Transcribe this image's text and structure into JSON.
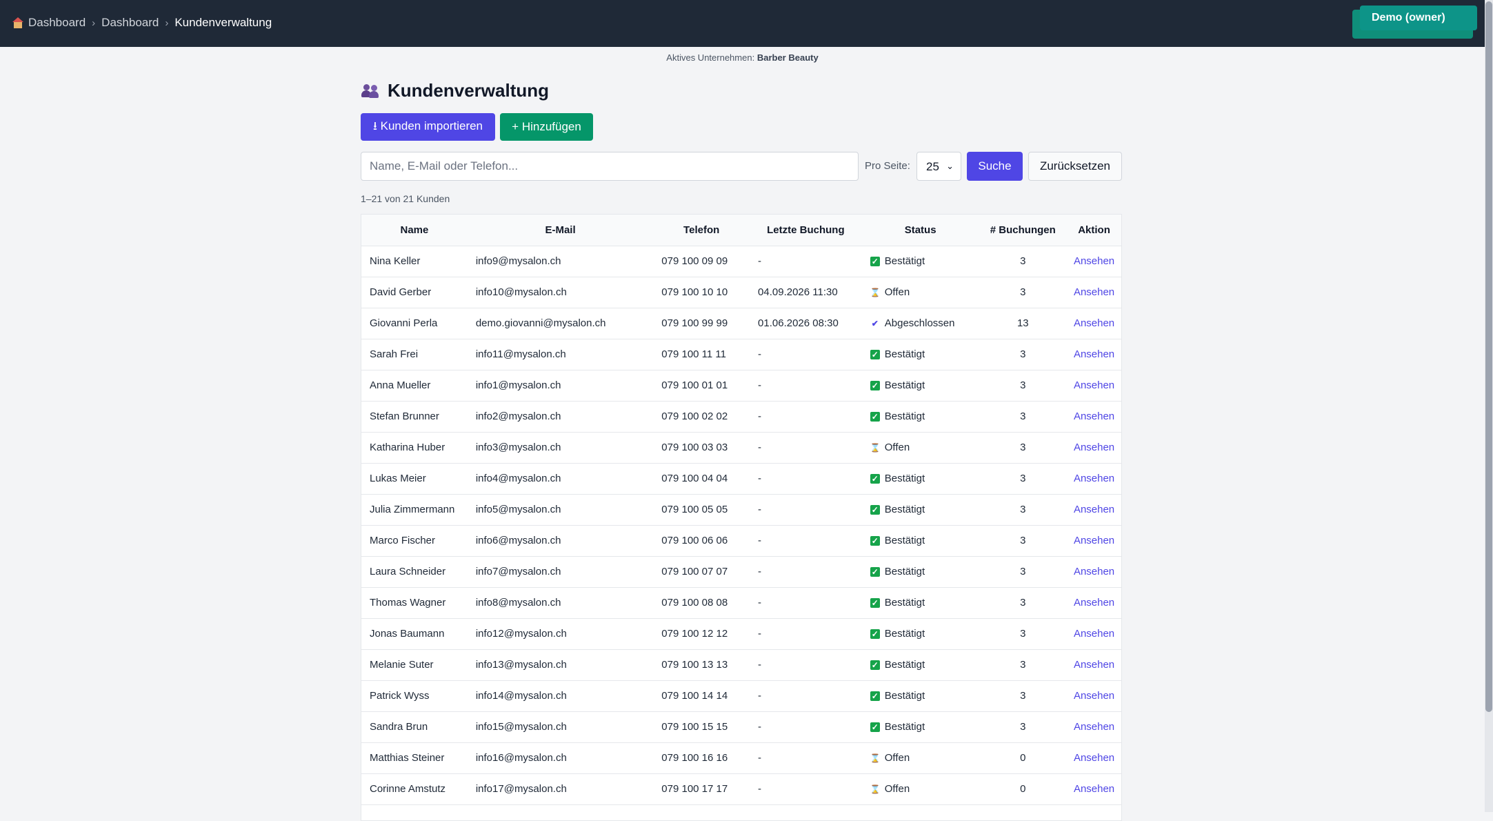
{
  "breadcrumb": {
    "home": "Dashboard",
    "parent": "Dashboard",
    "current": "Kundenverwaltung"
  },
  "user_badge": "Demo (owner)",
  "active_company": {
    "label": "Aktives Unternehmen:",
    "name": "Barber Beauty"
  },
  "page_title": "Kundenverwaltung",
  "toolbar": {
    "import_label": "⭳ Kunden importieren",
    "add_label": "+ Hinzufügen"
  },
  "search": {
    "placeholder": "Name, E-Mail oder Telefon...",
    "per_page_label": "Pro Seite:",
    "per_page_value": "25",
    "search_label": "Suche",
    "reset_label": "Zurücksetzen"
  },
  "result_count": "1–21 von 21 Kunden",
  "table": {
    "headers": [
      "Name",
      "E-Mail",
      "Telefon",
      "Letzte Buchung",
      "Status",
      "# Buchungen",
      "Aktion"
    ],
    "rows": [
      {
        "name": "Nina Keller",
        "email": "info9@mysalon.ch",
        "phone": "079 100 09 09",
        "last": "-",
        "status": "Bestätigt",
        "status_icon": "check-box-icon",
        "count": "3",
        "action": "Ansehen"
      },
      {
        "name": "David Gerber",
        "email": "info10@mysalon.ch",
        "phone": "079 100 10 10",
        "last": "04.09.2026 11:30",
        "status": "Offen",
        "status_icon": "hourglass-icon",
        "count": "3",
        "action": "Ansehen"
      },
      {
        "name": "Giovanni Perla",
        "email": "demo.giovanni@mysalon.ch",
        "phone": "079 100 99 99",
        "last": "01.06.2026 08:30",
        "status": "Abgeschlossen",
        "status_icon": "check-icon",
        "count": "13",
        "action": "Ansehen"
      },
      {
        "name": "Sarah Frei",
        "email": "info11@mysalon.ch",
        "phone": "079 100 11 11",
        "last": "-",
        "status": "Bestätigt",
        "status_icon": "check-box-icon",
        "count": "3",
        "action": "Ansehen"
      },
      {
        "name": "Anna Mueller",
        "email": "info1@mysalon.ch",
        "phone": "079 100 01 01",
        "last": "-",
        "status": "Bestätigt",
        "status_icon": "check-box-icon",
        "count": "3",
        "action": "Ansehen"
      },
      {
        "name": "Stefan Brunner",
        "email": "info2@mysalon.ch",
        "phone": "079 100 02 02",
        "last": "-",
        "status": "Bestätigt",
        "status_icon": "check-box-icon",
        "count": "3",
        "action": "Ansehen"
      },
      {
        "name": "Katharina Huber",
        "email": "info3@mysalon.ch",
        "phone": "079 100 03 03",
        "last": "-",
        "status": "Offen",
        "status_icon": "hourglass-icon",
        "count": "3",
        "action": "Ansehen"
      },
      {
        "name": "Lukas Meier",
        "email": "info4@mysalon.ch",
        "phone": "079 100 04 04",
        "last": "-",
        "status": "Bestätigt",
        "status_icon": "check-box-icon",
        "count": "3",
        "action": "Ansehen"
      },
      {
        "name": "Julia Zimmermann",
        "email": "info5@mysalon.ch",
        "phone": "079 100 05 05",
        "last": "-",
        "status": "Bestätigt",
        "status_icon": "check-box-icon",
        "count": "3",
        "action": "Ansehen"
      },
      {
        "name": "Marco Fischer",
        "email": "info6@mysalon.ch",
        "phone": "079 100 06 06",
        "last": "-",
        "status": "Bestätigt",
        "status_icon": "check-box-icon",
        "count": "3",
        "action": "Ansehen"
      },
      {
        "name": "Laura Schneider",
        "email": "info7@mysalon.ch",
        "phone": "079 100 07 07",
        "last": "-",
        "status": "Bestätigt",
        "status_icon": "check-box-icon",
        "count": "3",
        "action": "Ansehen"
      },
      {
        "name": "Thomas Wagner",
        "email": "info8@mysalon.ch",
        "phone": "079 100 08 08",
        "last": "-",
        "status": "Bestätigt",
        "status_icon": "check-box-icon",
        "count": "3",
        "action": "Ansehen"
      },
      {
        "name": "Jonas Baumann",
        "email": "info12@mysalon.ch",
        "phone": "079 100 12 12",
        "last": "-",
        "status": "Bestätigt",
        "status_icon": "check-box-icon",
        "count": "3",
        "action": "Ansehen"
      },
      {
        "name": "Melanie Suter",
        "email": "info13@mysalon.ch",
        "phone": "079 100 13 13",
        "last": "-",
        "status": "Bestätigt",
        "status_icon": "check-box-icon",
        "count": "3",
        "action": "Ansehen"
      },
      {
        "name": "Patrick Wyss",
        "email": "info14@mysalon.ch",
        "phone": "079 100 14 14",
        "last": "-",
        "status": "Bestätigt",
        "status_icon": "check-box-icon",
        "count": "3",
        "action": "Ansehen"
      },
      {
        "name": "Sandra Brun",
        "email": "info15@mysalon.ch",
        "phone": "079 100 15 15",
        "last": "-",
        "status": "Bestätigt",
        "status_icon": "check-box-icon",
        "count": "3",
        "action": "Ansehen"
      },
      {
        "name": "Matthias Steiner",
        "email": "info16@mysalon.ch",
        "phone": "079 100 16 16",
        "last": "-",
        "status": "Offen",
        "status_icon": "hourglass-icon",
        "count": "0",
        "action": "Ansehen"
      },
      {
        "name": "Corinne Amstutz",
        "email": "info17@mysalon.ch",
        "phone": "079 100 17 17",
        "last": "-",
        "status": "Offen",
        "status_icon": "hourglass-icon",
        "count": "0",
        "action": "Ansehen"
      }
    ]
  },
  "colors": {
    "topbar": "#1f2937",
    "primary": "#4f46e5",
    "success": "#059669",
    "owner_badge": "#0d9488"
  }
}
